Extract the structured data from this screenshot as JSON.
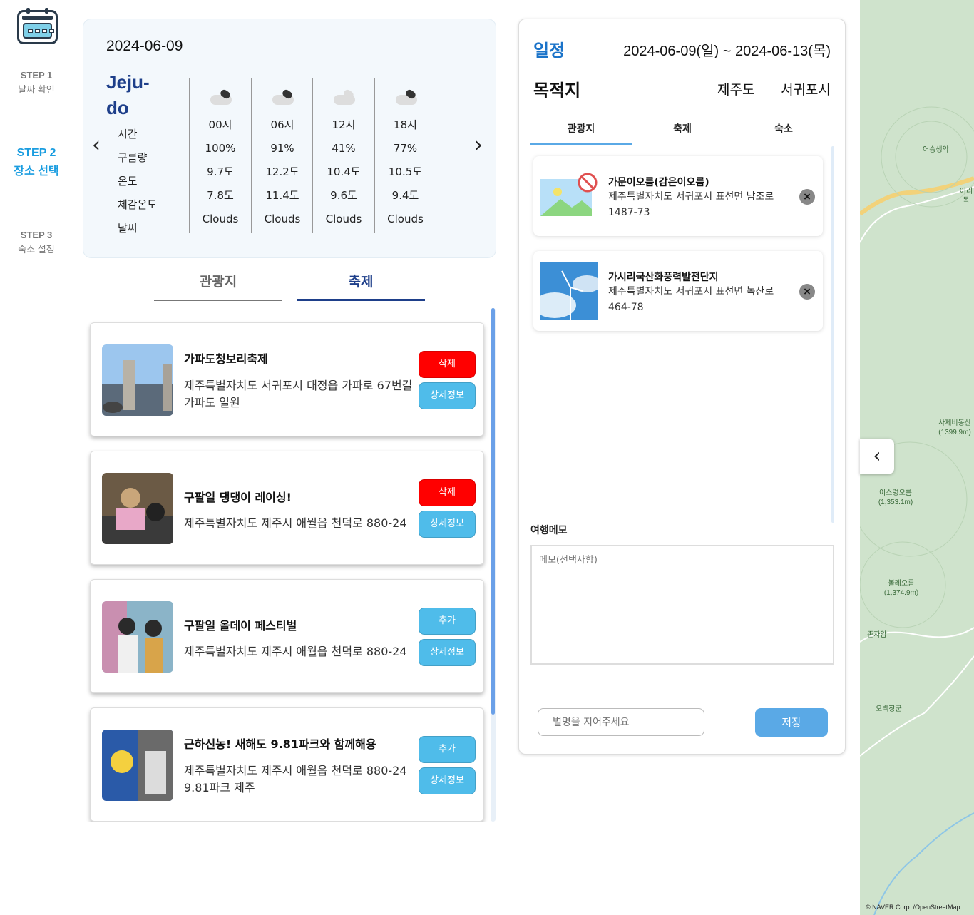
{
  "sidebar": {
    "steps": [
      {
        "num": "STEP 1",
        "label": "날짜 확인"
      },
      {
        "num": "STEP 2",
        "label": "장소 선택"
      },
      {
        "num": "STEP 3",
        "label": "숙소 설정"
      }
    ]
  },
  "weather": {
    "date": "2024-06-09",
    "city": "Jeju-do",
    "row_labels": [
      "시간",
      "구름량",
      "온도",
      "체감온도",
      "날씨"
    ],
    "columns": [
      {
        "time": "00시",
        "cloud": "100%",
        "temp": "9.7도",
        "feels": "7.8도",
        "desc": "Clouds",
        "icon": "dark-cloud-icon"
      },
      {
        "time": "06시",
        "cloud": "91%",
        "temp": "12.2도",
        "feels": "11.4도",
        "desc": "Clouds",
        "icon": "dark-cloud-icon"
      },
      {
        "time": "12시",
        "cloud": "41%",
        "temp": "10.4도",
        "feels": "9.6도",
        "desc": "Clouds",
        "icon": "light-cloud-icon"
      },
      {
        "time": "18시",
        "cloud": "77%",
        "temp": "10.5도",
        "feels": "9.4도",
        "desc": "Clouds",
        "icon": "dark-cloud-icon"
      }
    ]
  },
  "tabs": {
    "attractions": "관광지",
    "festivals": "축제"
  },
  "festivals": [
    {
      "title": "가파도청보리축제",
      "address": "제주특별자치도 서귀포시 대정읍 가파로 67번길 가파도 일원",
      "primary": "삭제",
      "primary_color": "#ff0000",
      "detail": "상세정보"
    },
    {
      "title": "구팔일 댕댕이 레이싱!",
      "address": "제주특별자치도 제주시 애월읍 천덕로 880-24",
      "primary": "삭제",
      "primary_color": "#ff0000",
      "detail": "상세정보"
    },
    {
      "title": "구팔일 올데이 페스티벌",
      "address": "제주특별자치도 제주시 애월읍 천덕로 880-24",
      "primary": "추가",
      "primary_color": "#4fbcea",
      "detail": "상세정보"
    },
    {
      "title": "근하신농! 새해도 9.81파크와 함께해용",
      "address": "제주특별자치도 제주시 애월읍 천덕로 880-24 9.81파크 제주",
      "primary": "추가",
      "primary_color": "#4fbcea",
      "detail": "상세정보"
    }
  ],
  "plan": {
    "schedule_label": "일정",
    "range": "2024-06-09(일) ~ 2024-06-13(목)",
    "destination_label": "목적지",
    "destination_1": "제주도",
    "destination_2": "서귀포시",
    "tabs": [
      "관광지",
      "축제",
      "숙소"
    ],
    "selected": [
      {
        "title": "가문이오름(감은이오름)",
        "address": "제주특별자치도 서귀포시 표선면 남조로 1487-73",
        "remove": "×"
      },
      {
        "title": "가시리국산화풍력발전단지",
        "address": "제주특별자치도 서귀포시 표선면 녹산로 464-78",
        "remove": "×"
      }
    ],
    "memo_label": "여행메모",
    "memo_placeholder": "메모(선택사항)",
    "nickname_placeholder": "별명을 지어주세요",
    "save_label": "저장"
  },
  "map": {
    "labels": [
      "어승생악",
      "어리목",
      "사제비동산 (1399.9m)",
      "이스렁오름 (1,353.1m)",
      "볼레오름 (1,374.9m)",
      "존자암",
      "오백장군"
    ],
    "copyright": "© NAVER Corp. /OpenStreetMap",
    "colors": {
      "land": "#cfe3cc",
      "road": "#f2d27a"
    }
  }
}
